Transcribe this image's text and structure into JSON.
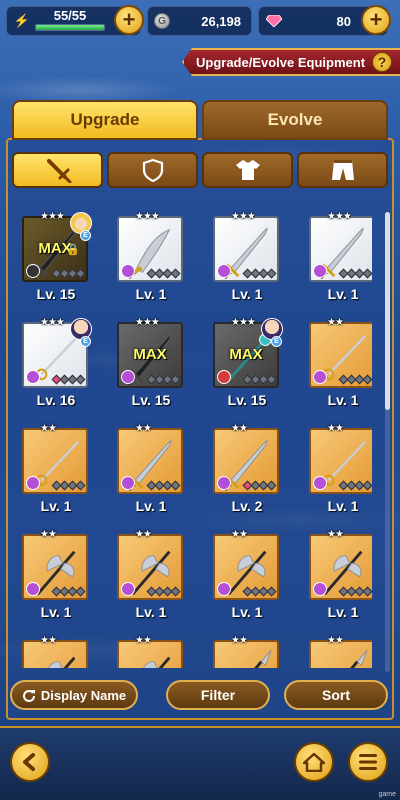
{
  "resources": {
    "stamina": {
      "text": "55/55",
      "fill": 1.0
    },
    "gold": {
      "value": "26,198"
    },
    "gems": {
      "value": "80"
    }
  },
  "header": {
    "title": "Upgrade/Evolve Equipment",
    "help": "?"
  },
  "tabs": [
    {
      "label": "Upgrade",
      "active": true
    },
    {
      "label": "Evolve",
      "active": false
    }
  ],
  "categories": [
    {
      "name": "sword-icon",
      "active": true
    },
    {
      "name": "shield-icon",
      "active": false
    },
    {
      "name": "armor-icon",
      "active": false
    },
    {
      "name": "pants-icon",
      "active": false
    }
  ],
  "equipment": [
    {
      "level": "Lv. 15",
      "bg": "darkgold",
      "stars": 3,
      "max": "MAX",
      "locked": true,
      "portrait": "blonde",
      "element": "dark",
      "weapon": "sword-dark"
    },
    {
      "level": "Lv. 1",
      "bg": "white",
      "stars": 3,
      "element": "purple",
      "weapon": "scimitar"
    },
    {
      "level": "Lv. 1",
      "bg": "white",
      "stars": 3,
      "element": "purple",
      "weapon": "longsword"
    },
    {
      "level": "Lv. 1",
      "bg": "white",
      "stars": 3,
      "element": "purple",
      "weapon": "longsword"
    },
    {
      "level": "Lv. 16",
      "bg": "white",
      "stars": 3,
      "portrait": "dark",
      "element": "purple",
      "weapon": "rapier",
      "pinkSlot": true
    },
    {
      "level": "Lv. 15",
      "bg": "gray",
      "stars": 3,
      "max": "MAX",
      "element": "purple",
      "weapon": "sword-dark"
    },
    {
      "level": "Lv. 15",
      "bg": "gray",
      "stars": 3,
      "max": "MAX",
      "portrait": "dark",
      "element": "red",
      "weapon": "staff"
    },
    {
      "level": "Lv. 1",
      "bg": "gold",
      "stars": 2,
      "element": "purple",
      "weapon": "rapier"
    },
    {
      "level": "Lv. 1",
      "bg": "gold",
      "stars": 2,
      "element": "purple",
      "weapon": "rapier"
    },
    {
      "level": "Lv. 1",
      "bg": "gold",
      "stars": 2,
      "element": "purple",
      "weapon": "longsword"
    },
    {
      "level": "Lv. 2",
      "bg": "gold",
      "stars": 2,
      "element": "purple",
      "weapon": "longsword",
      "pinkSlot": true
    },
    {
      "level": "Lv. 1",
      "bg": "gold",
      "stars": 2,
      "element": "purple",
      "weapon": "rapier"
    },
    {
      "level": "Lv. 1",
      "bg": "gold",
      "stars": 2,
      "element": "purple",
      "weapon": "axe"
    },
    {
      "level": "Lv. 1",
      "bg": "gold",
      "stars": 2,
      "element": "purple",
      "weapon": "axe"
    },
    {
      "level": "Lv. 1",
      "bg": "gold",
      "stars": 2,
      "element": "purple",
      "weapon": "axe"
    },
    {
      "level": "Lv. 1",
      "bg": "gold",
      "stars": 2,
      "element": "purple",
      "weapon": "axe"
    },
    {
      "level": "",
      "bg": "gold",
      "stars": 2,
      "element": "purple",
      "weapon": "axe"
    },
    {
      "level": "",
      "bg": "gold",
      "stars": 2,
      "element": "purple",
      "weapon": "axe"
    },
    {
      "level": "",
      "bg": "gold",
      "stars": 2,
      "element": "purple",
      "weapon": "spear"
    },
    {
      "level": "",
      "bg": "gold",
      "stars": 2,
      "element": "purple",
      "weapon": "spear"
    }
  ],
  "scroll": {
    "position": 0.0,
    "visible_fraction": 0.43
  },
  "actions": {
    "display_name": "Display Name",
    "filter": "Filter",
    "sort": "Sort"
  },
  "footer": {
    "watermark": "game"
  },
  "colors": {
    "accent": "#f2bb22",
    "banner": "#a4262c",
    "panel_border": "#c9902e"
  }
}
